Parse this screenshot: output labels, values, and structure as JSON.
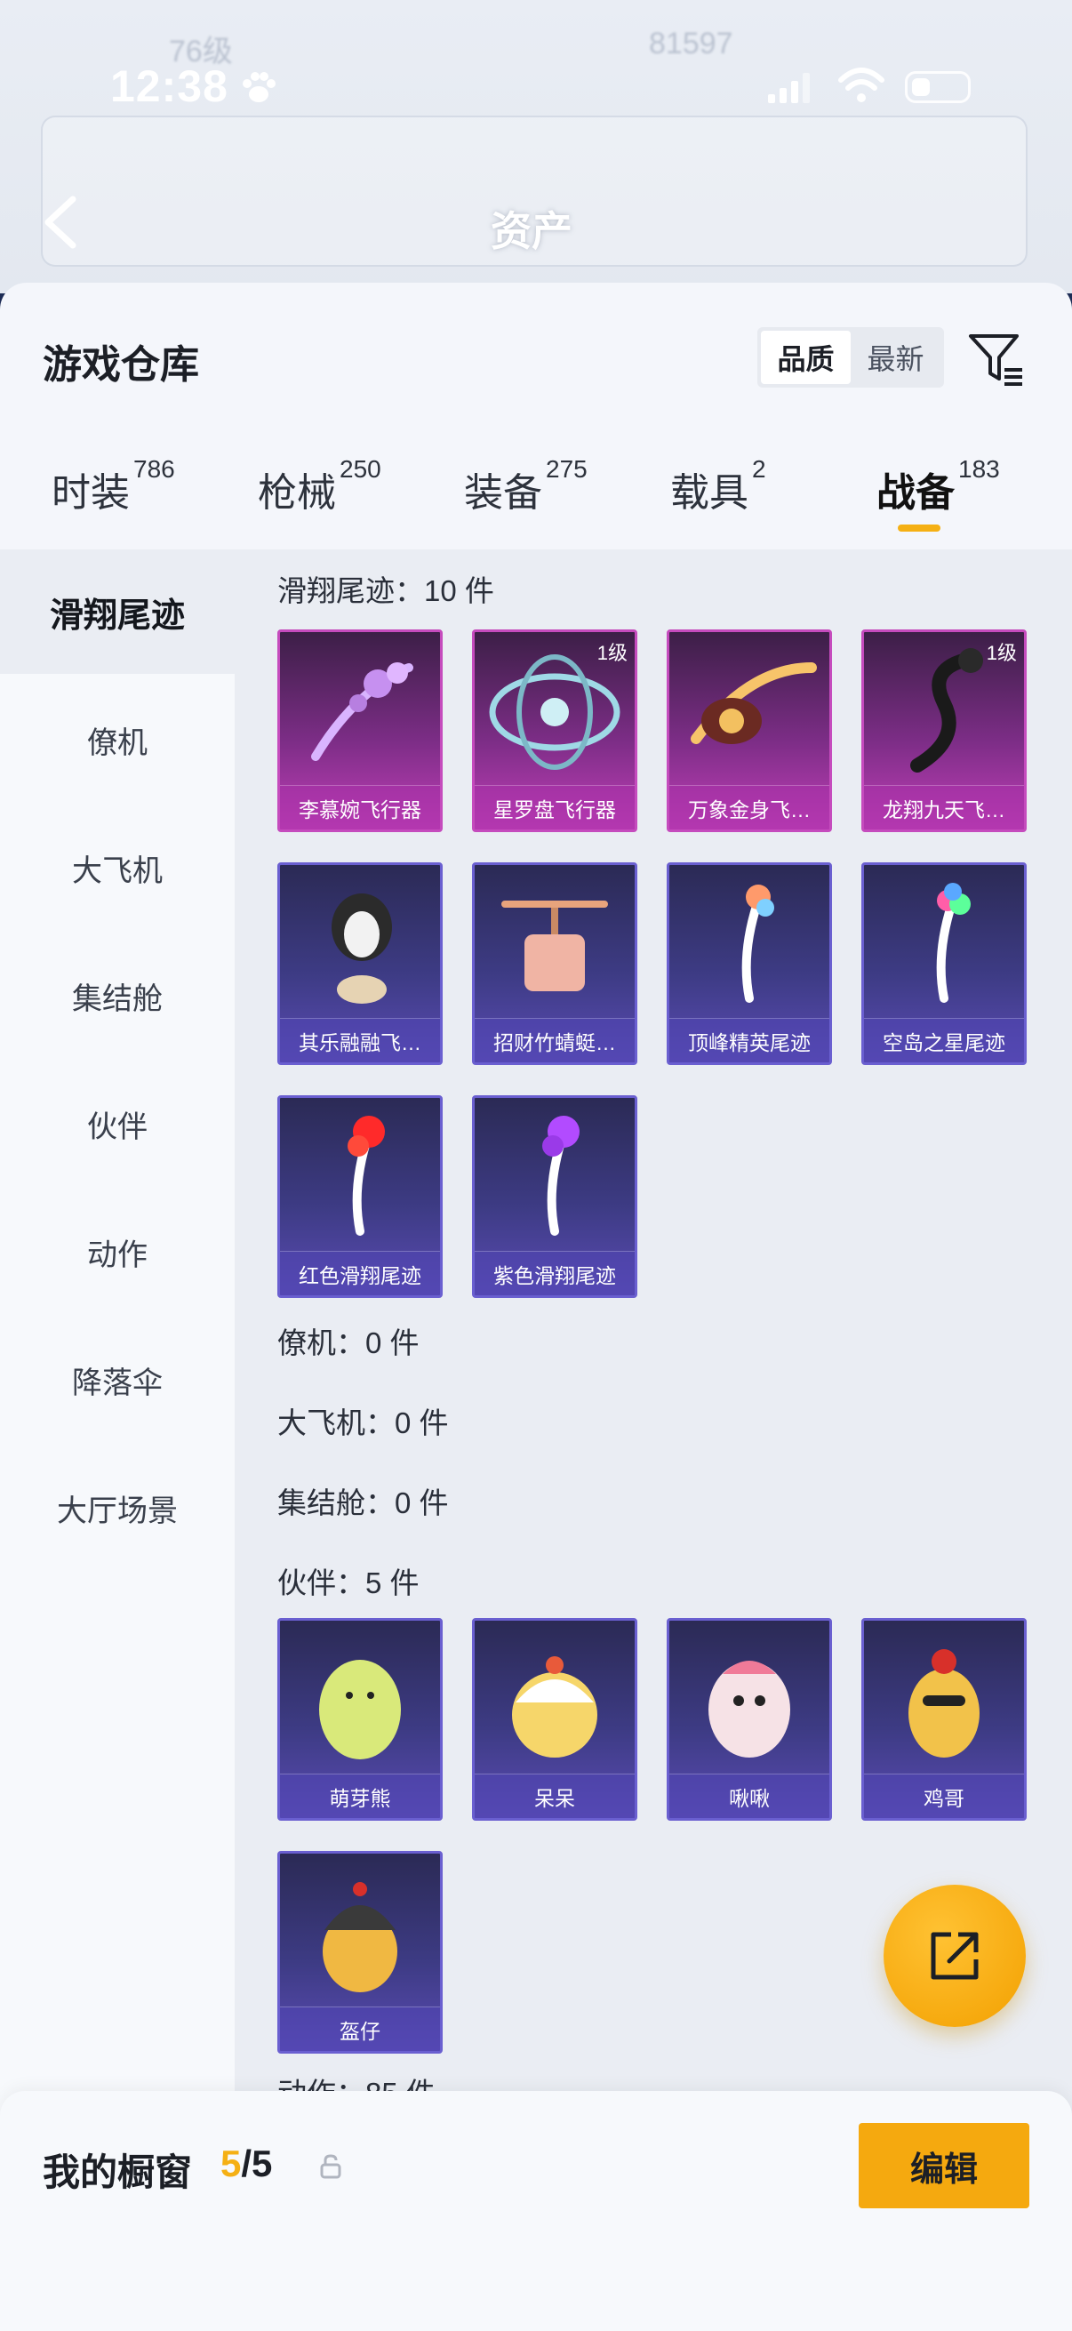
{
  "status_bar": {
    "time": "12:38"
  },
  "header": {
    "title": "资产"
  },
  "sheet": {
    "title": "游戏仓库",
    "sort_options": [
      "品质",
      "最新"
    ],
    "sort_selected": "品质"
  },
  "tabs": [
    {
      "label": "时装",
      "count": "786"
    },
    {
      "label": "枪械",
      "count": "250"
    },
    {
      "label": "装备",
      "count": "275"
    },
    {
      "label": "载具",
      "count": "2"
    },
    {
      "label": "战备",
      "count": "183"
    }
  ],
  "sidebar": {
    "items": [
      "滑翔尾迹",
      "僚机",
      "大飞机",
      "集结舱",
      "伙伴",
      "动作",
      "降落伞",
      "大厅场景"
    ]
  },
  "sections": {
    "glide": {
      "heading": "滑翔尾迹：10 件"
    },
    "wingman": {
      "heading": "僚机：0 件"
    },
    "plane": {
      "heading": "大飞机：0 件"
    },
    "pod": {
      "heading": "集结舱：0 件"
    },
    "partner": {
      "heading": "伙伴：5 件"
    },
    "action": {
      "heading": "动作：85 件"
    }
  },
  "glide_items": [
    {
      "name": "李慕婉飞行器",
      "level": "",
      "rarity": "purple"
    },
    {
      "name": "星罗盘飞行器",
      "level": "1级",
      "rarity": "purple"
    },
    {
      "name": "万象金身飞…",
      "level": "",
      "rarity": "purple"
    },
    {
      "name": "龙翔九天飞…",
      "level": "1级",
      "rarity": "purple"
    },
    {
      "name": "其乐融融飞…",
      "level": "",
      "rarity": "blue"
    },
    {
      "name": "招财竹蜻蜓…",
      "level": "",
      "rarity": "blue"
    },
    {
      "name": "顶峰精英尾迹",
      "level": "",
      "rarity": "blue"
    },
    {
      "name": "空岛之星尾迹",
      "level": "",
      "rarity": "blue"
    },
    {
      "name": "红色滑翔尾迹",
      "level": "",
      "rarity": "blue"
    },
    {
      "name": "紫色滑翔尾迹",
      "level": "",
      "rarity": "blue"
    }
  ],
  "partner_items": [
    {
      "name": "萌芽熊"
    },
    {
      "name": "呆呆"
    },
    {
      "name": "啾啾"
    },
    {
      "name": "鸡哥"
    },
    {
      "name": "盔仔"
    }
  ],
  "bottom_bar": {
    "title": "我的橱窗",
    "current": "5",
    "separator_total": "/5",
    "edit_label": "编辑"
  },
  "colors": {
    "accent": "#f5b014",
    "purple_rarity": "#c54bbd",
    "blue_rarity": "#6a5fd0"
  }
}
